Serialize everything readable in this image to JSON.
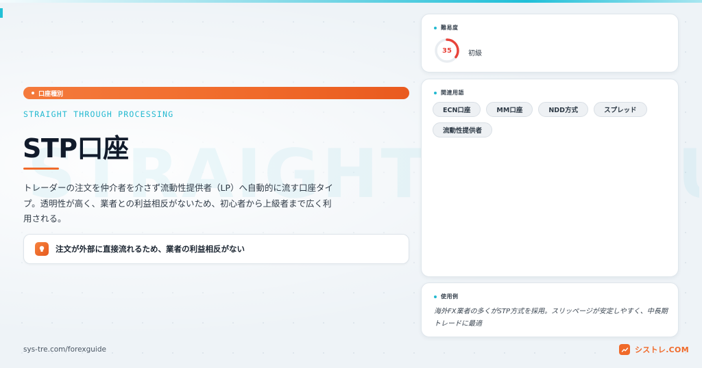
{
  "watermark": "STRAIGHT THROUGH",
  "category_tag": "口座種別",
  "english_subtitle": "STRAIGHT THROUGH PROCESSING",
  "title": "STP口座",
  "description": "トレーダーの注文を仲介者を介さず流動性提供者（LP）へ自動的に流す口座タイプ。透明性が高く、業者との利益相反がないため、初心者から上級者まで広く利用される。",
  "key_point": "注文が外部に直接流れるため、業者の利益相反がない",
  "footer_url": "sys-tre.com/forexguide",
  "brand": "シストレ.COM",
  "difficulty": {
    "label": "難易度",
    "score": "35",
    "score_fraction": 0.35,
    "level": "初級",
    "accent_color": "#e8433a"
  },
  "related_terms": {
    "label": "関連用語",
    "items": [
      "ECN口座",
      "MM口座",
      "NDD方式",
      "スプレッド",
      "流動性提供者"
    ]
  },
  "usage_example": {
    "label": "使用例",
    "text": "海外FX業者の多くがSTP方式を採用。スリッページが安定しやすく、中長期トレードに最適"
  },
  "colors": {
    "orange": "#f06a2a",
    "cyan": "#22b9d0",
    "title": "#111b2b"
  }
}
